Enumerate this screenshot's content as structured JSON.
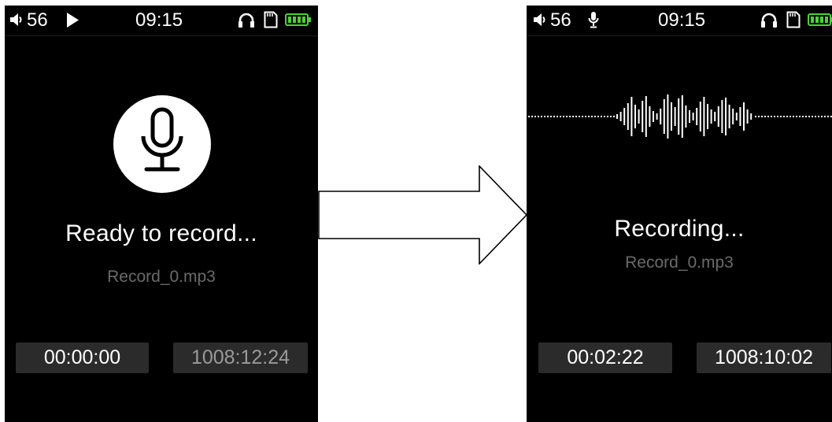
{
  "left_screen": {
    "status": {
      "volume": "56",
      "playback_icon": "play-icon",
      "time": "09:15"
    },
    "title": "Ready to record...",
    "filename": "Record_0.mp3",
    "elapsed": "00:00:00",
    "remaining": "1008:12:24"
  },
  "right_screen": {
    "status": {
      "volume": "56",
      "mode_icon": "microphone-icon",
      "time": "09:15"
    },
    "title": "Recording...",
    "filename": "Record_0.mp3",
    "elapsed": "00:02:22",
    "remaining": "1008:10:02"
  },
  "colors": {
    "screen_bg": "#000000",
    "text": "#ffffff",
    "muted_text": "#6a6a6a",
    "box_bg": "#2b2b2b",
    "battery": "#4cd137"
  }
}
